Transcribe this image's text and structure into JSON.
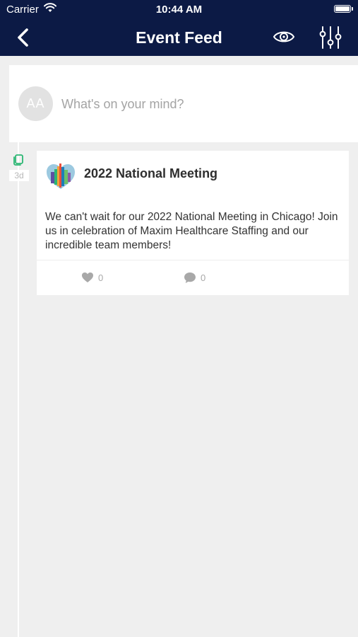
{
  "status_bar": {
    "carrier": "Carrier",
    "time": "10:44 AM"
  },
  "nav": {
    "title": "Event Feed"
  },
  "composer": {
    "avatar_initials": "AA",
    "placeholder": "What's on your mind?"
  },
  "feed": {
    "posts": [
      {
        "age": "3d",
        "title": "2022 National Meeting",
        "body": "We can't wait for our 2022 National Meeting in Chicago! Join us in celebration of Maxim Healthcare Staffing and our incredible team members!",
        "likes": "0",
        "comments": "0"
      }
    ]
  },
  "colors": {
    "header_bg": "#0c1a45",
    "page_bg": "#efefef",
    "accent_green": "#2bb673",
    "muted_icon": "#a8a8a8"
  },
  "icons": {
    "back": "chevron-left-icon",
    "eye": "eye-icon",
    "filter": "sliders-icon",
    "post_type": "post-icon",
    "like": "heart-icon",
    "comment": "comment-icon"
  }
}
